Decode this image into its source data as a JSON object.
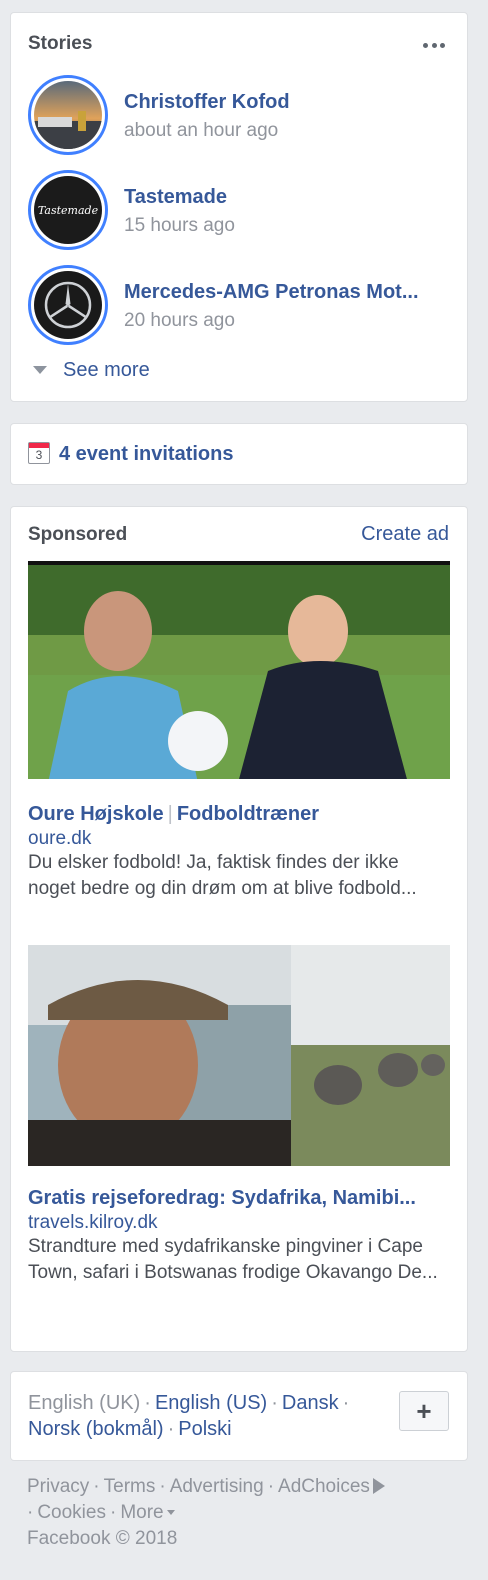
{
  "stories": {
    "title": "Stories",
    "items": [
      {
        "name": "Christoffer Kofod",
        "time": "about an hour ago"
      },
      {
        "name": "Tastemade",
        "time": "15 hours ago",
        "avatar_text": "Tastemade"
      },
      {
        "name": "Mercedes-AMG Petronas Mot...",
        "time": "20 hours ago"
      }
    ],
    "see_more": "See more"
  },
  "events": {
    "icon_number": "3",
    "label": "4 event invitations"
  },
  "sponsored": {
    "title": "Sponsored",
    "create_ad": "Create ad",
    "ads": [
      {
        "title_a": "Oure Højskole",
        "separator": "|",
        "title_b": "Fodboldtræner",
        "domain": "oure.dk",
        "description": "Du elsker fodbold! Ja, faktisk findes der ikke noget bedre og din drøm om at blive fodbold..."
      },
      {
        "title": "Gratis rejseforedrag: Sydafrika, Namibi...",
        "domain": "travels.kilroy.dk",
        "description": "Strandture med sydafrikanske pingviner i Cape Town, safari i Botswanas frodige Okavango De..."
      }
    ]
  },
  "languages": {
    "current": "English (UK)",
    "links": [
      "English (US)",
      "Dansk",
      "Norsk (bokmål)",
      "Polski"
    ],
    "add_label": "+"
  },
  "footer": {
    "links": [
      "Privacy",
      "Terms",
      "Advertising",
      "AdChoices",
      "Cookies",
      "More"
    ],
    "copyright": "Facebook © 2018"
  },
  "colors": {
    "link": "#365899",
    "ring": "#4080ff",
    "background": "#e9ebee"
  }
}
